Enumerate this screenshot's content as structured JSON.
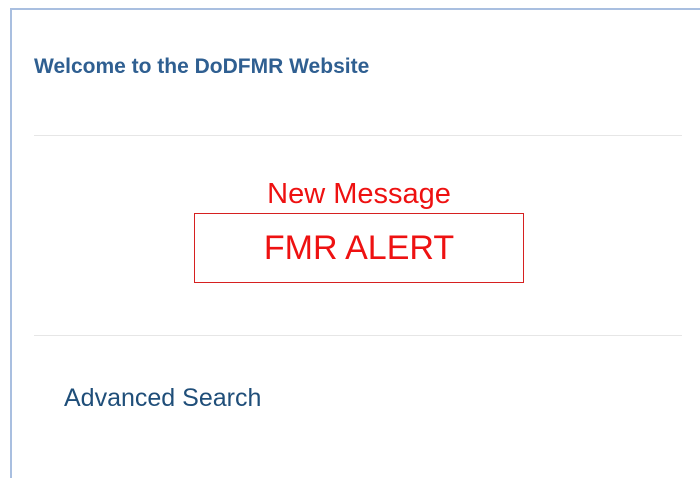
{
  "header": {
    "welcome_text": "Welcome to the DoDFMR Website"
  },
  "message": {
    "heading": "New Message",
    "alert_label": "FMR ALERT"
  },
  "links": {
    "advanced_search": "Advanced Search"
  },
  "colors": {
    "title_blue": "#2f5f91",
    "alert_red": "#ee1111",
    "panel_border": "#a9bfe0",
    "link_blue": "#1f4e79"
  }
}
